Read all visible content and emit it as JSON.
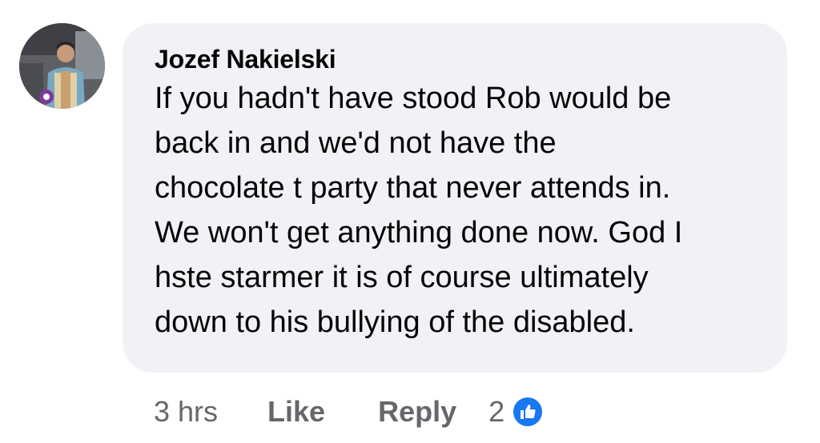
{
  "comment": {
    "author": "Jozef Nakielski",
    "text": "If you hadn't have stood Rob would be\nback in and we'd not have the\nchocolate t party that never attends in.\nWe won't get anything done now. God I\nhste starmer it is of course ultimately\ndown to his bullying of the disabled.",
    "timestamp": "3 hrs",
    "like_label": "Like",
    "reply_label": "Reply",
    "reaction_count": "2",
    "reaction_icon": "like-icon"
  },
  "colors": {
    "bubble": "#f0f2f5",
    "text": "#050505",
    "secondary": "#65676b",
    "reaction": "#1877f2"
  }
}
